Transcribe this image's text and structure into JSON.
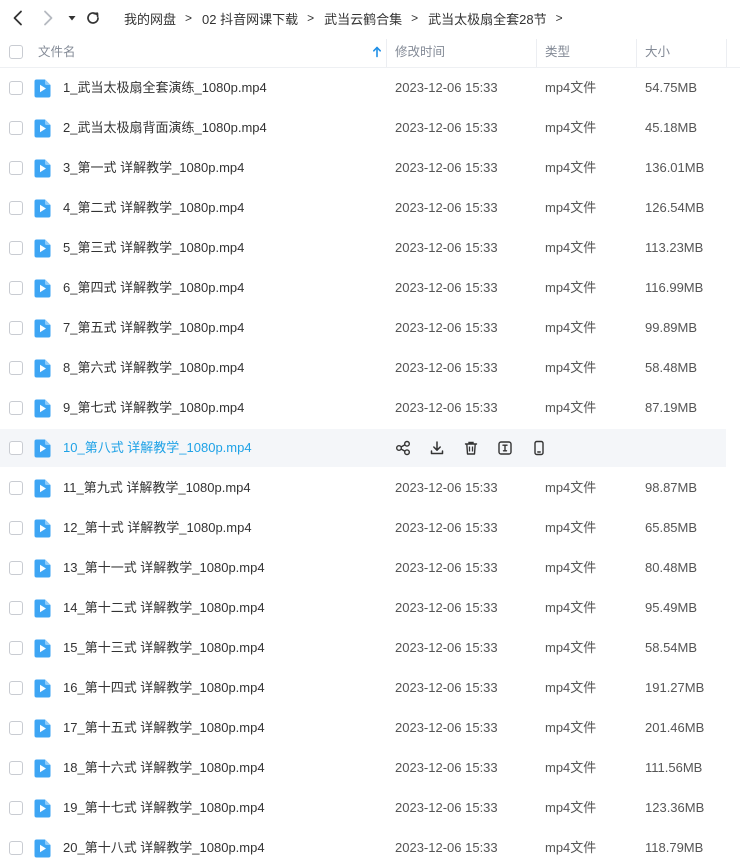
{
  "nav": {
    "back_icon": "chevron-left-icon",
    "forward_icon": "chevron-right-icon",
    "dropdown_icon": "caret-down-icon",
    "refresh_icon": "refresh-icon"
  },
  "breadcrumb": [
    {
      "label": "我的网盘"
    },
    {
      "label": "02 抖音网课下载"
    },
    {
      "label": "武当云鹤合集"
    },
    {
      "label": "武当太极扇全套28节"
    }
  ],
  "breadcrumb_separator": ">",
  "columns": {
    "name": "文件名",
    "modified": "修改时间",
    "type": "类型",
    "size": "大小"
  },
  "accent_color": "#1fa2e6",
  "files": [
    {
      "name": "1_武当太极扇全套演练_1080p.mp4",
      "modified": "2023-12-06 15:33",
      "type": "mp4文件",
      "size": "54.75MB"
    },
    {
      "name": "2_武当太极扇背面演练_1080p.mp4",
      "modified": "2023-12-06 15:33",
      "type": "mp4文件",
      "size": "45.18MB"
    },
    {
      "name": "3_第一式 详解教学_1080p.mp4",
      "modified": "2023-12-06 15:33",
      "type": "mp4文件",
      "size": "136.01MB"
    },
    {
      "name": "4_第二式 详解教学_1080p.mp4",
      "modified": "2023-12-06 15:33",
      "type": "mp4文件",
      "size": "126.54MB"
    },
    {
      "name": "5_第三式 详解教学_1080p.mp4",
      "modified": "2023-12-06 15:33",
      "type": "mp4文件",
      "size": "113.23MB"
    },
    {
      "name": "6_第四式 详解教学_1080p.mp4",
      "modified": "2023-12-06 15:33",
      "type": "mp4文件",
      "size": "116.99MB"
    },
    {
      "name": "7_第五式 详解教学_1080p.mp4",
      "modified": "2023-12-06 15:33",
      "type": "mp4文件",
      "size": "99.89MB"
    },
    {
      "name": "8_第六式 详解教学_1080p.mp4",
      "modified": "2023-12-06 15:33",
      "type": "mp4文件",
      "size": "58.48MB"
    },
    {
      "name": "9_第七式 详解教学_1080p.mp4",
      "modified": "2023-12-06 15:33",
      "type": "mp4文件",
      "size": "87.19MB"
    },
    {
      "name": "10_第八式 详解教学_1080p.mp4",
      "hovered": true,
      "actions": [
        "share-icon",
        "download-icon",
        "delete-icon",
        "rename-icon",
        "phone-icon"
      ]
    },
    {
      "name": "11_第九式 详解教学_1080p.mp4",
      "modified": "2023-12-06 15:33",
      "type": "mp4文件",
      "size": "98.87MB"
    },
    {
      "name": "12_第十式 详解教学_1080p.mp4",
      "modified": "2023-12-06 15:33",
      "type": "mp4文件",
      "size": "65.85MB"
    },
    {
      "name": "13_第十一式 详解教学_1080p.mp4",
      "modified": "2023-12-06 15:33",
      "type": "mp4文件",
      "size": "80.48MB"
    },
    {
      "name": "14_第十二式 详解教学_1080p.mp4",
      "modified": "2023-12-06 15:33",
      "type": "mp4文件",
      "size": "95.49MB"
    },
    {
      "name": "15_第十三式 详解教学_1080p.mp4",
      "modified": "2023-12-06 15:33",
      "type": "mp4文件",
      "size": "58.54MB"
    },
    {
      "name": "16_第十四式 详解教学_1080p.mp4",
      "modified": "2023-12-06 15:33",
      "type": "mp4文件",
      "size": "191.27MB"
    },
    {
      "name": "17_第十五式 详解教学_1080p.mp4",
      "modified": "2023-12-06 15:33",
      "type": "mp4文件",
      "size": "201.46MB"
    },
    {
      "name": "18_第十六式 详解教学_1080p.mp4",
      "modified": "2023-12-06 15:33",
      "type": "mp4文件",
      "size": "111.56MB"
    },
    {
      "name": "19_第十七式 详解教学_1080p.mp4",
      "modified": "2023-12-06 15:33",
      "type": "mp4文件",
      "size": "123.36MB"
    },
    {
      "name": "20_第十八式 详解教学_1080p.mp4",
      "modified": "2023-12-06 15:33",
      "type": "mp4文件",
      "size": "118.79MB"
    }
  ]
}
